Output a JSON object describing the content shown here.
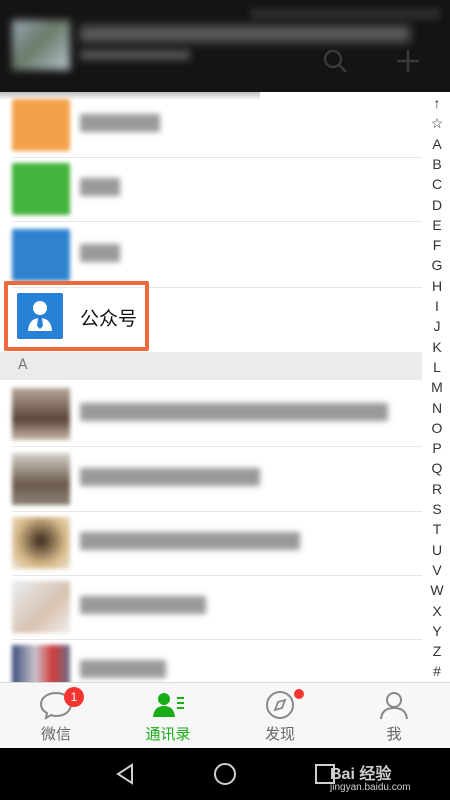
{
  "header": {
    "search_icon": "search-icon",
    "add_icon": "plus-icon"
  },
  "official_accounts": {
    "label": "公众号",
    "icon": "person-tie-icon"
  },
  "section_header": "A",
  "alphabet_index": [
    "↑",
    "☆",
    "A",
    "B",
    "C",
    "D",
    "E",
    "F",
    "G",
    "H",
    "I",
    "J",
    "K",
    "L",
    "M",
    "N",
    "O",
    "P",
    "Q",
    "R",
    "S",
    "T",
    "U",
    "V",
    "W",
    "X",
    "Y",
    "Z",
    "#"
  ],
  "tabs": [
    {
      "label": "微信",
      "icon": "chat-bubble-icon",
      "badge": "1",
      "active": false
    },
    {
      "label": "通讯录",
      "icon": "contacts-icon",
      "badge": "",
      "active": true
    },
    {
      "label": "发现",
      "icon": "compass-icon",
      "badge": "",
      "active": false
    },
    {
      "label": "我",
      "icon": "person-icon",
      "badge": "",
      "active": false
    }
  ],
  "watermark": {
    "brand": "Bai 经验",
    "site": "jingyan.baidu.com"
  },
  "colors": {
    "accent_green": "#1aad19",
    "badge_red": "#f43530",
    "highlight_orange": "#ee6a3b",
    "official_blue": "#2782d7"
  }
}
